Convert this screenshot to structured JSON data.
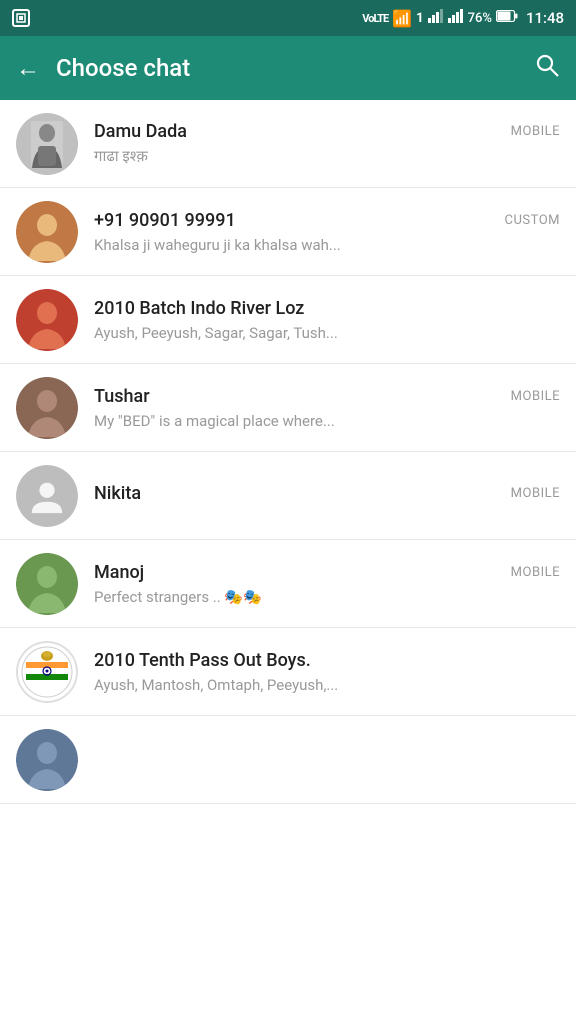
{
  "statusBar": {
    "leftIcon": "screenshot",
    "icons": [
      "volte",
      "wifi",
      "sim1",
      "signal",
      "signal2"
    ],
    "battery": "76%",
    "time": "11:48"
  },
  "header": {
    "backLabel": "←",
    "title": "Choose chat",
    "searchIcon": "🔍"
  },
  "contacts": [
    {
      "id": "damu-dada",
      "name": "Damu Dada",
      "label": "MOBILE",
      "status": "गाढा इश्क़",
      "avatarType": "bw-photo",
      "avatarClass": "avatar-damu"
    },
    {
      "id": "number-91",
      "name": "+91 90901 99991",
      "label": "CUSTOM",
      "status": "Khalsa ji waheguru ji ka khalsa wah...",
      "avatarType": "photo",
      "avatarClass": "avatar-number"
    },
    {
      "id": "batch-2010",
      "name": "2010 Batch Indo River Loz",
      "label": "",
      "status": "Ayush, Peeyush, Sagar, Sagar, Tush...",
      "avatarType": "photo",
      "avatarClass": "avatar-batch2010"
    },
    {
      "id": "tushar",
      "name": "Tushar",
      "label": "MOBILE",
      "status": "My \"BED\" is a magical place where...",
      "avatarType": "photo",
      "avatarClass": "avatar-tushar"
    },
    {
      "id": "nikita",
      "name": "Nikita",
      "label": "MOBILE",
      "status": "",
      "avatarType": "default",
      "avatarClass": "avatar-nikita"
    },
    {
      "id": "manoj",
      "name": "Manoj",
      "label": "MOBILE",
      "status": "Perfect strangers .. 🎭🎭",
      "avatarType": "photo",
      "avatarClass": "avatar-manoj"
    },
    {
      "id": "tenth-boys",
      "name": "2010 Tenth Pass Out Boys.",
      "label": "",
      "status": "Ayush, Mantosh, Omtaph, Peeyush,...",
      "avatarType": "flag",
      "avatarClass": "avatar-tenth"
    },
    {
      "id": "partial",
      "name": "",
      "label": "",
      "status": "",
      "avatarType": "photo",
      "avatarClass": "avatar-partial"
    }
  ]
}
